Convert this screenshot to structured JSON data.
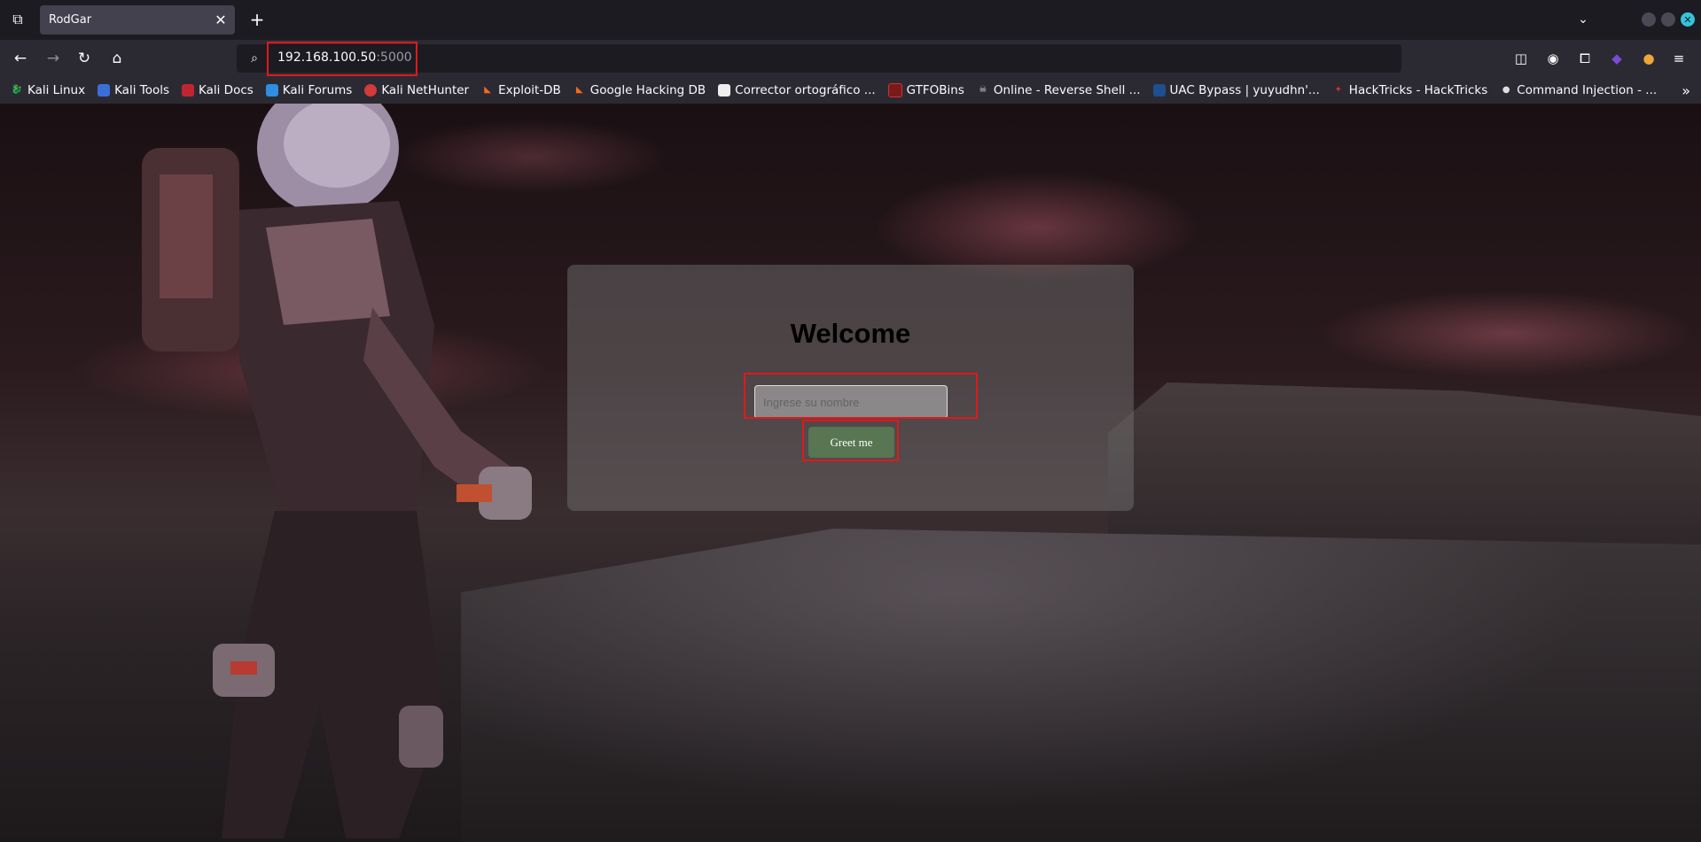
{
  "browser": {
    "tab_title": "RodGar",
    "url_host": "192.168.100.50",
    "url_port": ":5000"
  },
  "bookmarks": [
    {
      "label": "Kali Linux",
      "icon": "kali-dragon-icon"
    },
    {
      "label": "Kali Tools",
      "icon": "kali-tools-icon"
    },
    {
      "label": "Kali Docs",
      "icon": "kali-docs-icon"
    },
    {
      "label": "Kali Forums",
      "icon": "kali-forums-icon"
    },
    {
      "label": "Kali NetHunter",
      "icon": "nethunter-icon"
    },
    {
      "label": "Exploit-DB",
      "icon": "exploit-db-icon"
    },
    {
      "label": "Google Hacking DB",
      "icon": "ghdb-icon"
    },
    {
      "label": "Corrector ortográfico ...",
      "icon": "corrector-icon"
    },
    {
      "label": "GTFOBins",
      "icon": "gtfobins-icon"
    },
    {
      "label": "Online - Reverse Shell ...",
      "icon": "skull-icon"
    },
    {
      "label": "UAC Bypass | yuyudhn'...",
      "icon": "uac-icon"
    },
    {
      "label": "HackTricks - HackTricks",
      "icon": "hacktricks-icon"
    },
    {
      "label": "Command Injection - ...",
      "icon": "command-injection-icon"
    }
  ],
  "page": {
    "heading": "Welcome",
    "name_placeholder": "Ingrese su nombre",
    "button_label": "Greet me"
  },
  "colors": {
    "highlight": "#e0191b",
    "button": "#577651"
  }
}
